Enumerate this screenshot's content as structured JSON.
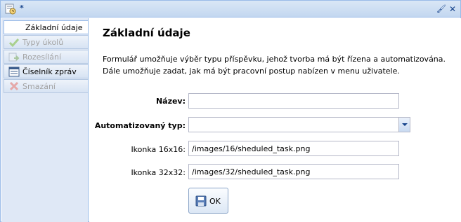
{
  "window": {
    "title": "*",
    "icons": [
      "app-icon",
      "pin-icon",
      "close-icon"
    ]
  },
  "sidebar": {
    "items": [
      {
        "label": "Základní údaje",
        "icon": "none",
        "active": true,
        "enabled": true
      },
      {
        "label": "Typy úkolů",
        "icon": "checkmark-icon",
        "active": false,
        "enabled": false
      },
      {
        "label": "Rozesílání",
        "icon": "send-icon",
        "active": false,
        "enabled": false
      },
      {
        "label": "Číselník zpráv",
        "icon": "list-icon",
        "active": false,
        "enabled": true
      },
      {
        "label": "Smazání",
        "icon": "delete-icon",
        "active": false,
        "enabled": false
      }
    ]
  },
  "main": {
    "heading": "Základní údaje",
    "description": "Formulář umožňuje výběr typu příspěvku, jehož tvorba má být řízena a automatizována. Dále umožňuje zadat, jak má být pracovní postup nabízen v menu uživatele.",
    "form": {
      "name": {
        "label": "Název:",
        "value": ""
      },
      "type": {
        "label": "Automatizovaný typ:",
        "value": ""
      },
      "icon16": {
        "label": "Ikonka 16x16:",
        "value": "/images/16/sheduled_task.png"
      },
      "icon32": {
        "label": "Ikonka 32x32:",
        "value": "/images/32/sheduled_task.png"
      }
    },
    "ok_label": "OK"
  },
  "colors": {
    "border": "#99bbe8",
    "sidebar_bg": "#dfe8f6",
    "title_text": "#15428b"
  }
}
